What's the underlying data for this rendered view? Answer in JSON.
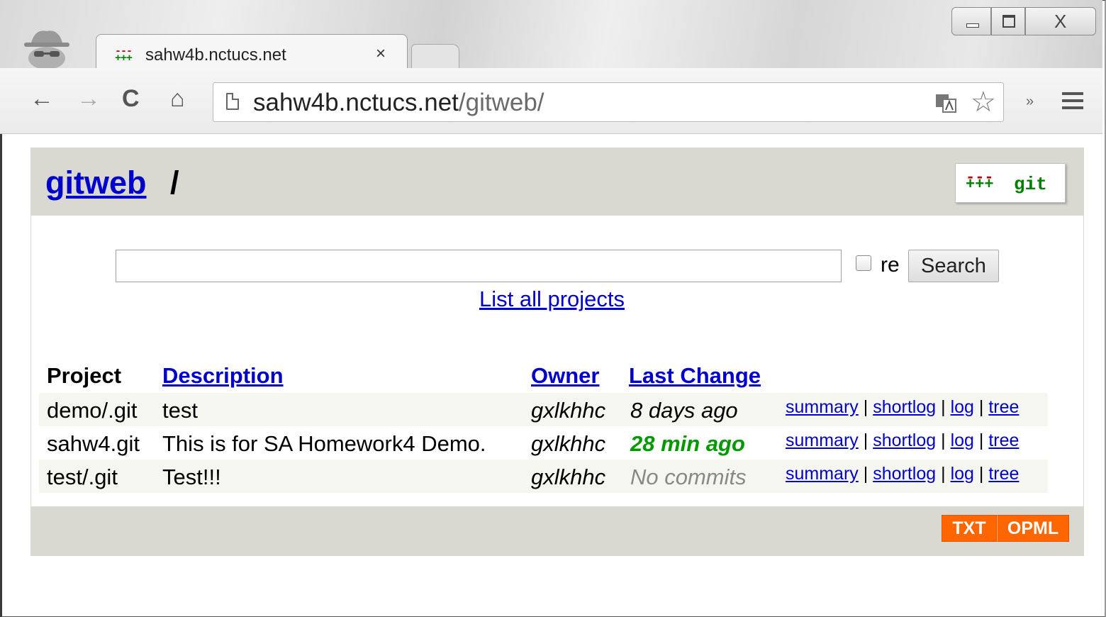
{
  "browser": {
    "tab_title": "sahw4b.nctucs.net",
    "tab_close": "×",
    "url_host": "sahw4b.nctucs.net",
    "url_path": "/gitweb/",
    "back": "←",
    "forward": "→",
    "reload": "C",
    "home": "⌂",
    "star": "☆",
    "extensions": "»",
    "window_close": "X"
  },
  "header": {
    "home_link": "gitweb",
    "separator": "/",
    "logo_text": "git",
    "logo_minus": "---",
    "logo_plus": "+++"
  },
  "search": {
    "input_value": "",
    "regex_label": "re",
    "regex_checked": false,
    "button_label": "Search",
    "list_all_link": "List all projects"
  },
  "table": {
    "columns": [
      "Project",
      "Description",
      "Owner",
      "Last Change"
    ],
    "rows": [
      {
        "project": "demo/.git",
        "description": "test",
        "owner": "gxlkhhc",
        "last_change": "8 days ago",
        "links": [
          "summary",
          "shortlog",
          "log",
          "tree"
        ]
      },
      {
        "project": "sahw4.git",
        "description": "This is for SA Homework4 Demo.",
        "owner": "gxlkhhc",
        "last_change": "28 min ago",
        "links": [
          "summary",
          "shortlog",
          "log",
          "tree"
        ]
      },
      {
        "project": "test/.git",
        "description": "Test!!!",
        "owner": "gxlkhhc",
        "last_change": "No commits",
        "links": [
          "summary",
          "shortlog",
          "log",
          "tree"
        ]
      }
    ],
    "link_separator": "|"
  },
  "footer": {
    "feeds": [
      "TXT",
      "OPML"
    ]
  },
  "colors": {
    "link": "#0000cc",
    "header_bg": "#d9d8d1",
    "recent_change": "#009900",
    "feed_bg": "#ff6600"
  }
}
